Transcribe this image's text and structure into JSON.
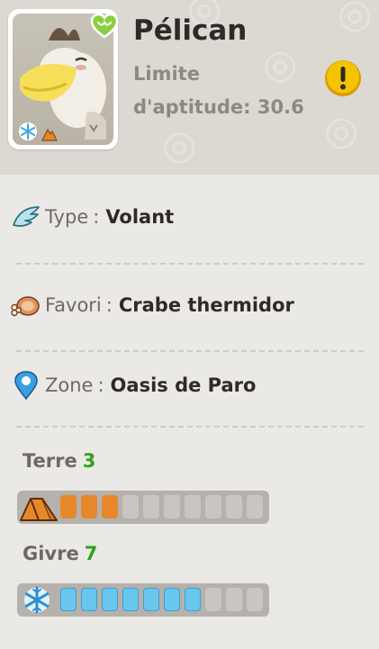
{
  "pet": {
    "name": "Pélican",
    "aptitude_line1": "Limite",
    "aptitude_line2": "d'aptitude: 30.6"
  },
  "info": {
    "type_label": "Type",
    "type_value": "Volant",
    "favori_label": "Favori",
    "favori_value": "Crabe thermidor",
    "zone_label": "Zone",
    "zone_value": "Oasis de Paro",
    "separator": ":"
  },
  "stats": [
    {
      "label": "Terre",
      "value": "3",
      "level": 3,
      "max": 10,
      "color": "#e6882a",
      "icon": "terre-icon"
    },
    {
      "label": "Givre",
      "value": "7",
      "level": 7,
      "max": 10,
      "color": "#69c6ee",
      "icon": "givre-icon"
    }
  ],
  "colors": {
    "stat_number": "#2ea21b",
    "warning": "#f5c400"
  }
}
